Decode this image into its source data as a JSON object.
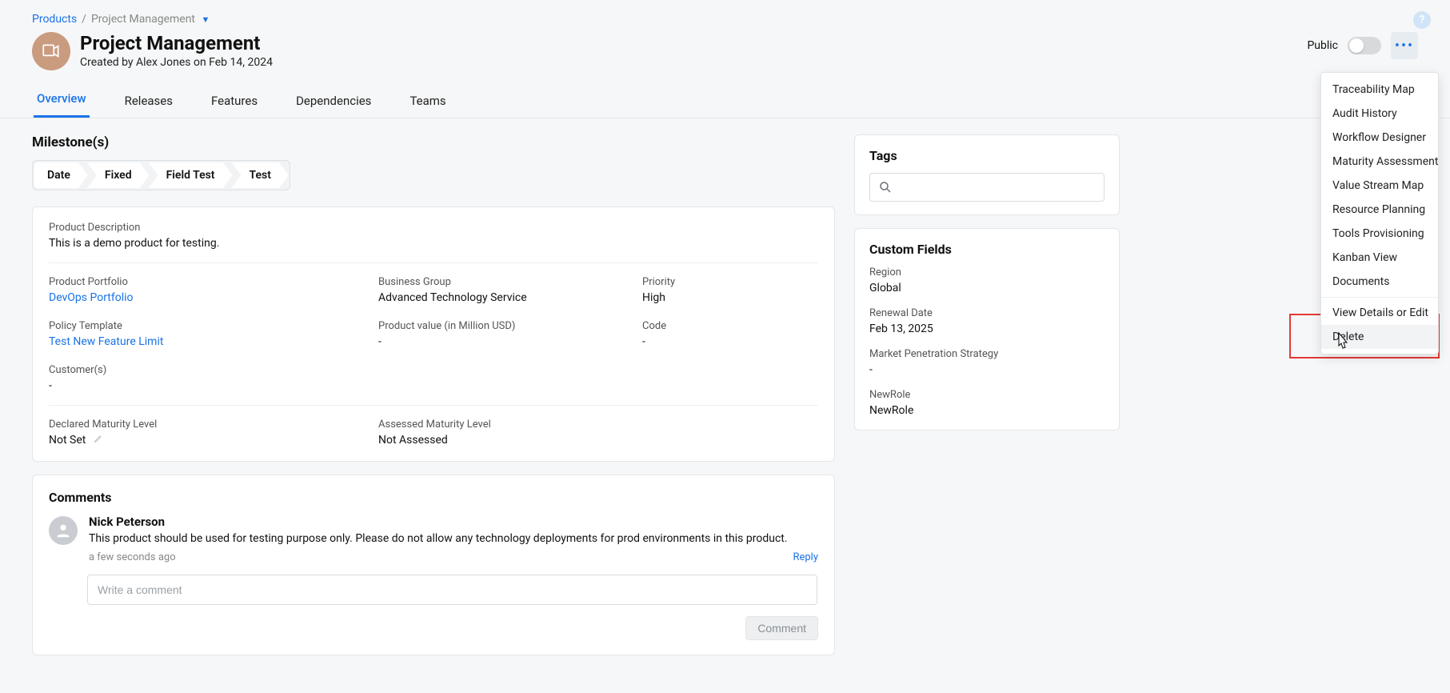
{
  "breadcrumb": {
    "root": "Products",
    "sep": "/",
    "current": "Project Management"
  },
  "header": {
    "title": "Project Management",
    "subtitle": "Created by Alex Jones on Feb 14, 2024",
    "public_label": "Public"
  },
  "tabs": [
    "Overview",
    "Releases",
    "Features",
    "Dependencies",
    "Teams"
  ],
  "active_tab": "Overview",
  "milestones": {
    "title": "Milestone(s)",
    "steps": [
      "Date",
      "Fixed",
      "Field Test",
      "Test"
    ]
  },
  "description": {
    "label": "Product Description",
    "text": "This is a demo product for testing."
  },
  "fields": {
    "portfolio_label": "Product Portfolio",
    "portfolio_value": "DevOps Portfolio",
    "business_group_label": "Business Group",
    "business_group_value": "Advanced Technology Service",
    "priority_label": "Priority",
    "priority_value": "High",
    "policy_label": "Policy Template",
    "policy_value": "Test New Feature Limit",
    "product_value_label": "Product value (in Million USD)",
    "product_value_value": "-",
    "code_label": "Code",
    "code_value": "-",
    "customers_label": "Customer(s)",
    "customers_value": "-",
    "declared_maturity_label": "Declared Maturity Level",
    "declared_maturity_value": "Not Set",
    "assessed_maturity_label": "Assessed Maturity Level",
    "assessed_maturity_value": "Not Assessed"
  },
  "comments": {
    "title": "Comments",
    "author": "Nick Peterson",
    "text": "This product should be used for testing purpose only. Please do not allow any technology deployments for prod environments in this product.",
    "time": "a few seconds ago",
    "reply": "Reply",
    "placeholder": "Write a comment",
    "submit": "Comment"
  },
  "tags": {
    "title": "Tags",
    "search_placeholder": ""
  },
  "custom_fields": {
    "title": "Custom Fields",
    "items": [
      {
        "label": "Region",
        "value": "Global"
      },
      {
        "label": "Renewal Date",
        "value": "Feb 13, 2025"
      },
      {
        "label": "Market Penetration Strategy",
        "value": "-"
      },
      {
        "label": "NewRole",
        "value": "NewRole"
      }
    ]
  },
  "menu": {
    "items": [
      "Traceability Map",
      "Audit History",
      "Workflow Designer",
      "Maturity Assessment",
      "Value Stream Map",
      "Resource Planning",
      "Tools Provisioning",
      "Kanban View",
      "Documents"
    ],
    "bottom": [
      "View Details or Edit",
      "Delete"
    ]
  }
}
